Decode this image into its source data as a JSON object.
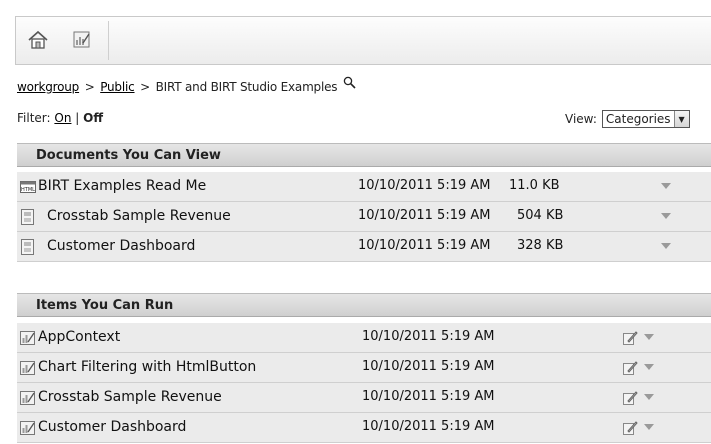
{
  "breadcrumb": {
    "items": [
      "workgroup",
      "Public",
      "BIRT and BIRT Studio Examples"
    ],
    "separator": ">"
  },
  "filter": {
    "label": "Filter:",
    "on": "On",
    "divider": "|",
    "off": "Off"
  },
  "view": {
    "label": "View:",
    "selected": "Categories"
  },
  "documents": {
    "title": "Documents You Can View",
    "rows": [
      {
        "name": "BIRT Examples Read Me",
        "date": "10/10/2011 5:19 AM",
        "size": "11.0 KB",
        "icon": "html-doc-icon"
      },
      {
        "name": "Crosstab Sample Revenue",
        "date": "10/10/2011 5:19 AM",
        "size": "504 KB",
        "icon": "report-doc-icon"
      },
      {
        "name": "Customer Dashboard",
        "date": "10/10/2011 5:19 AM",
        "size": "328 KB",
        "icon": "report-doc-icon"
      }
    ]
  },
  "runnables": {
    "title": "Items You Can Run",
    "rows": [
      {
        "name": "AppContext",
        "date": "10/10/2011 5:19 AM",
        "icon": "report-design-icon"
      },
      {
        "name": "Chart Filtering with HtmlButton",
        "date": "10/10/2011 5:19 AM",
        "icon": "report-design-icon"
      },
      {
        "name": "Crosstab Sample Revenue",
        "date": "10/10/2011 5:19 AM",
        "icon": "report-design-icon"
      },
      {
        "name": "Customer Dashboard",
        "date": "10/10/2011 5:19 AM",
        "icon": "report-design-icon"
      }
    ]
  },
  "colors": {
    "header_bg": "#d9d9d9",
    "row_bg": "#ebebeb",
    "menu_arrow": "#9a9a9a"
  }
}
